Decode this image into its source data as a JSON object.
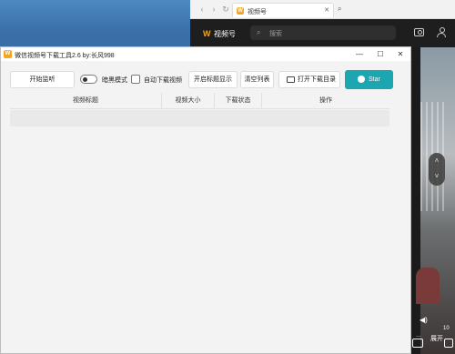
{
  "browser": {
    "tab_title": "视频号",
    "logo_text": "W",
    "site_name": "视频号",
    "search_placeholder": "搜索",
    "bottom_text_1": "10",
    "bottom_text_2": "…",
    "expand_label": "展开"
  },
  "app": {
    "title": "微信视频号下载工具2.6 by:长风998",
    "logo_text": "W",
    "window_buttons": {
      "minimize": "—",
      "maximize": "☐",
      "close": "✕"
    },
    "toolbar": {
      "start_label": "开始监听",
      "dark_mode_label": "暗黑模式",
      "dark_mode_on": false,
      "auto_download_label": "自动下载视频",
      "auto_download_checked": false,
      "title_display_label": "开启标题显示",
      "clear_list_label": "清空列表",
      "open_dir_label": "打开下载目录",
      "star_label": "Star"
    },
    "table": {
      "columns": [
        "视频标题",
        "视频大小",
        "下载状态",
        "操作"
      ],
      "rows": []
    }
  },
  "colors": {
    "accent": "#1ba6b1",
    "brand": "#f5a623"
  }
}
